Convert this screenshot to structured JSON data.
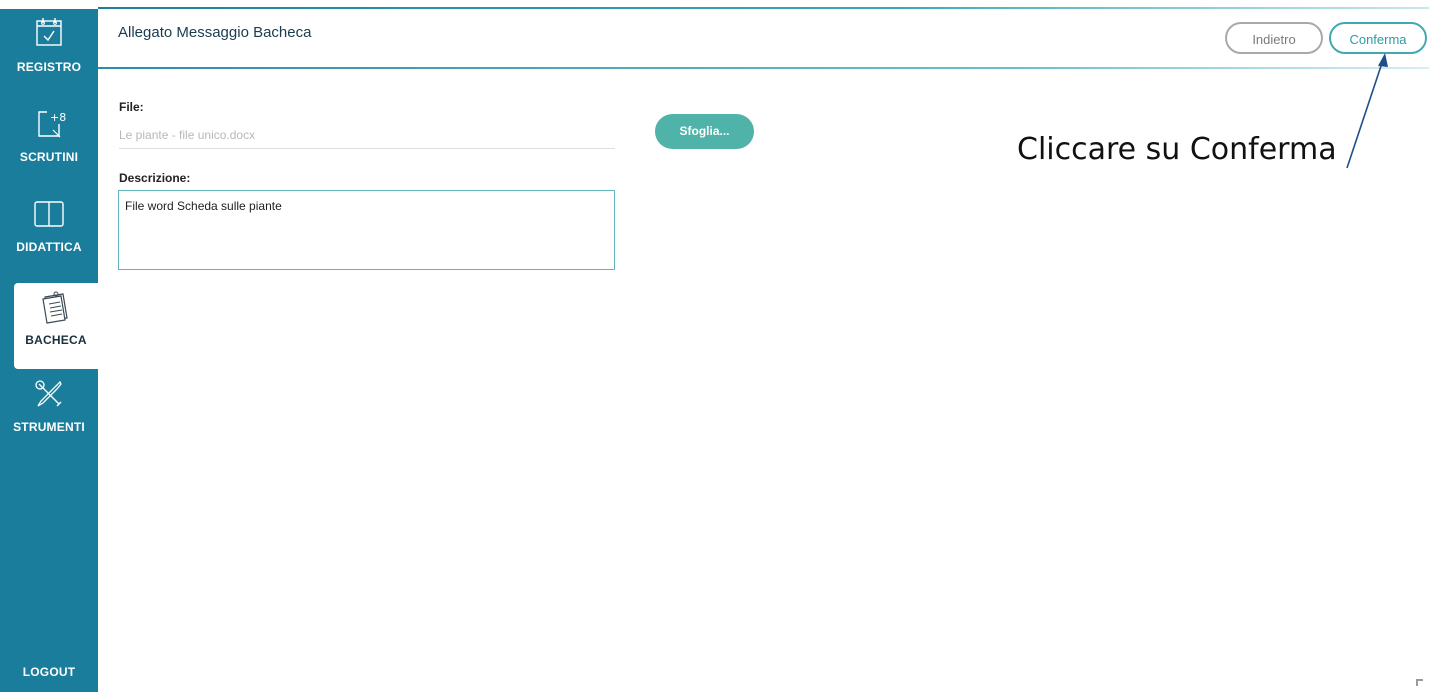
{
  "sidebar": {
    "items": [
      {
        "label": "REGISTRO",
        "icon": "calendar-check-icon"
      },
      {
        "label": "SCRUTINI",
        "icon": "grade-plus-icon"
      },
      {
        "label": "DIDATTICA",
        "icon": "open-book-icon"
      },
      {
        "label": "BACHECA",
        "icon": "notice-board-icon",
        "active": true
      },
      {
        "label": "STRUMENTI",
        "icon": "tools-icon"
      }
    ],
    "logout_label": "LOGOUT"
  },
  "header": {
    "title": "Allegato Messaggio Bacheca",
    "back_label": "Indietro",
    "confirm_label": "Conferma"
  },
  "form": {
    "file_label": "File:",
    "file_value": "Le piante - file unico.docx",
    "browse_label": "Sfoglia...",
    "description_label": "Descrizione:",
    "description_value": "File word Scheda sulle piante"
  },
  "annotation": {
    "text": "Cliccare su Conferma"
  },
  "colors": {
    "sidebar": "#1a7d9b",
    "accent": "#41aab1",
    "browse_button": "#4fb3a9",
    "arrow": "#1f4e8c"
  }
}
